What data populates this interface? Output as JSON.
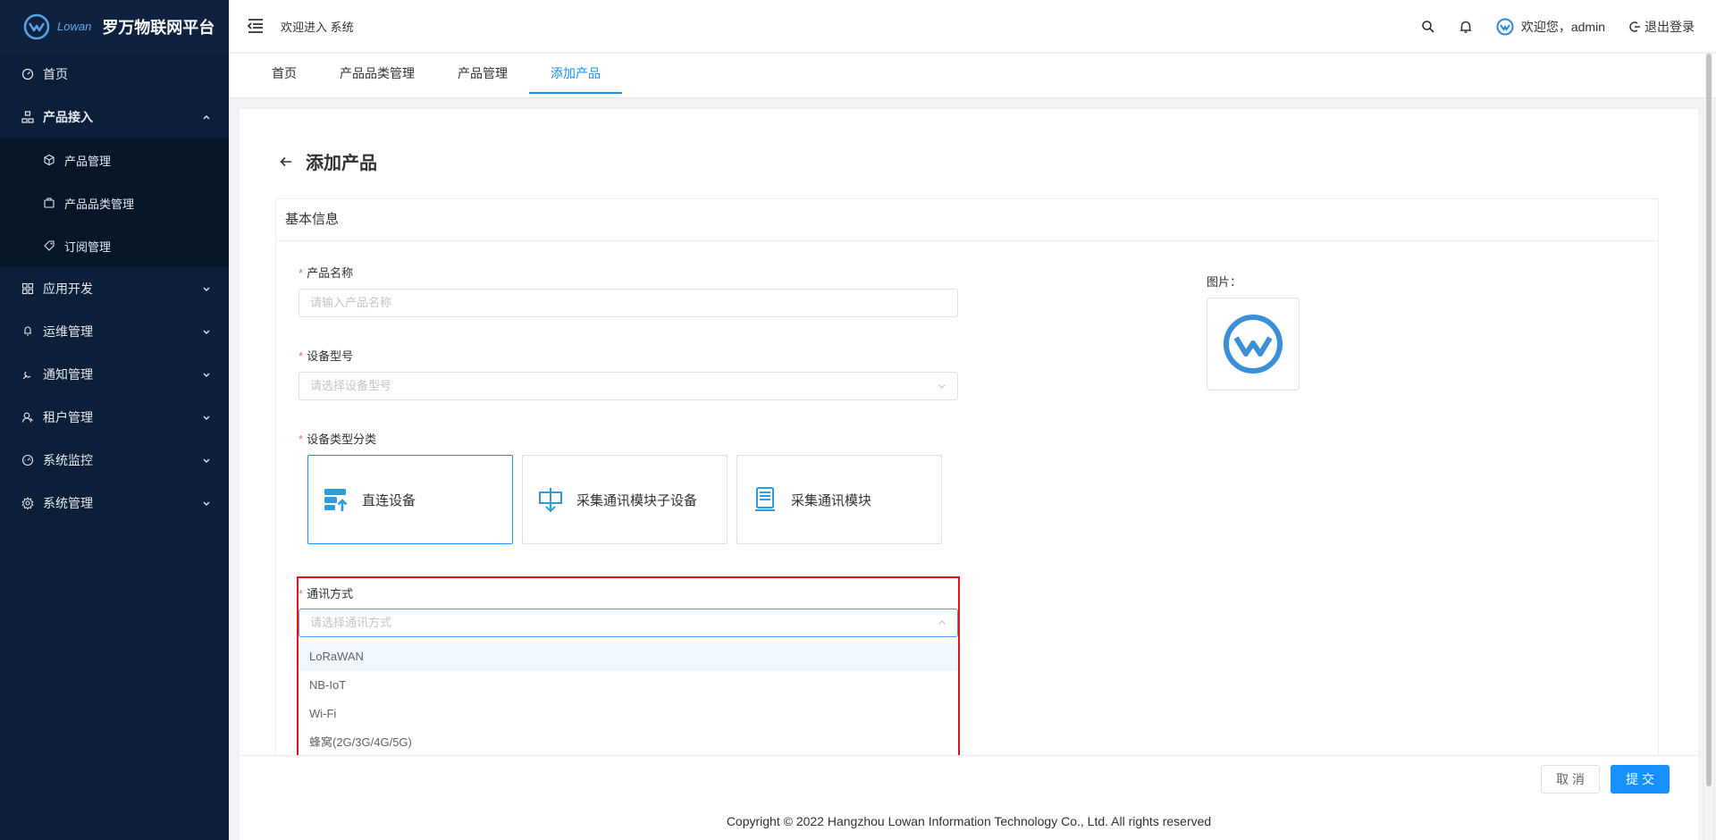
{
  "app": {
    "logo_sub": "Lowan",
    "title": "罗万物联网平台"
  },
  "sidebar": {
    "items": [
      {
        "label": "首页",
        "icon": "dashboard-icon"
      },
      {
        "label": "产品接入",
        "icon": "product-icon",
        "open": true,
        "children": [
          {
            "label": "产品管理",
            "icon": "cube-icon"
          },
          {
            "label": "产品品类管理",
            "icon": "category-icon"
          },
          {
            "label": "订阅管理",
            "icon": "tag-icon"
          }
        ]
      },
      {
        "label": "应用开发",
        "icon": "app-icon"
      },
      {
        "label": "运维管理",
        "icon": "maintenance-icon"
      },
      {
        "label": "通知管理",
        "icon": "notify-icon"
      },
      {
        "label": "租户管理",
        "icon": "tenant-icon"
      },
      {
        "label": "系统监控",
        "icon": "monitor-icon"
      },
      {
        "label": "系统管理",
        "icon": "settings-icon"
      }
    ]
  },
  "header": {
    "welcome": "欢迎进入 系统",
    "user_greeting": "欢迎您，admin",
    "logout": "退出登录"
  },
  "tabs": [
    {
      "label": "首页"
    },
    {
      "label": "产品品类管理"
    },
    {
      "label": "产品管理"
    },
    {
      "label": "添加产品",
      "active": true
    }
  ],
  "page": {
    "title": "添加产品",
    "section_title": "基本信息",
    "fields": {
      "product_name": {
        "label": "产品名称",
        "placeholder": "请输入产品名称"
      },
      "device_model": {
        "label": "设备型号",
        "placeholder": "请选择设备型号"
      },
      "device_type": {
        "label": "设备类型分类"
      },
      "comm_method": {
        "label": "通讯方式",
        "placeholder": "请选择通讯方式"
      }
    },
    "device_types": [
      {
        "label": "直连设备",
        "selected": true
      },
      {
        "label": "采集通讯模块子设备"
      },
      {
        "label": "采集通讯模块"
      }
    ],
    "comm_options": [
      "LoRaWAN",
      "NB-IoT",
      "Wi-Fi",
      "蜂窝(2G/3G/4G/5G)"
    ],
    "image_label": "图片："
  },
  "footer": {
    "cancel": "取 消",
    "submit": "提 交",
    "copyright": "Copyright © 2022 Hangzhou Lowan Information Technology Co., Ltd. All rights reserved"
  },
  "colors": {
    "primary": "#1890ff",
    "sidebar_bg": "#0c1f3a",
    "highlight": "#e8141a",
    "required": "#f56c6c"
  }
}
